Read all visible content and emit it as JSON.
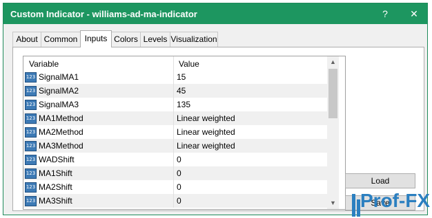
{
  "window": {
    "title": "Custom Indicator - williams-ad-ma-indicator",
    "help_icon": "?",
    "close_icon": "✕"
  },
  "tabs": [
    {
      "label": "About"
    },
    {
      "label": "Common"
    },
    {
      "label": "Inputs"
    },
    {
      "label": "Colors"
    },
    {
      "label": "Levels"
    },
    {
      "label": "Visualization"
    }
  ],
  "active_tab": "Inputs",
  "grid": {
    "header": {
      "variable": "Variable",
      "value": "Value"
    },
    "icon_text": "123",
    "rows": [
      {
        "name": "SignalMA1",
        "value": "15"
      },
      {
        "name": "SignalMA2",
        "value": "45"
      },
      {
        "name": "SignalMA3",
        "value": "135"
      },
      {
        "name": "MA1Method",
        "value": "Linear weighted"
      },
      {
        "name": "MA2Method",
        "value": "Linear weighted"
      },
      {
        "name": "MA3Method",
        "value": "Linear weighted"
      },
      {
        "name": "WADShift",
        "value": "0"
      },
      {
        "name": "MA1Shift",
        "value": "0"
      },
      {
        "name": "MA2Shift",
        "value": "0"
      },
      {
        "name": "MA3Shift",
        "value": "0"
      }
    ],
    "scroll_up_icon": "▲",
    "scroll_down_icon": "▼"
  },
  "buttons": {
    "load": "Load",
    "save": "Save"
  },
  "watermark": {
    "text": "Prof-FX"
  },
  "colors": {
    "titlebar": "#1d9660",
    "icon": "#3d7ab5",
    "watermark": "#2b7fc0"
  }
}
